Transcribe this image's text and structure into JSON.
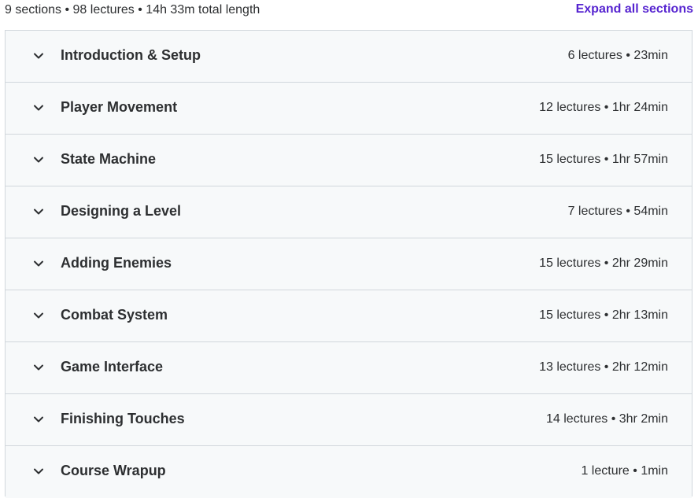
{
  "summary": {
    "text": "9 sections • 98 lectures • 14h 33m total length",
    "expand_label": "Expand all sections"
  },
  "sections": [
    {
      "title": "Introduction & Setup",
      "meta": "6 lectures • 23min"
    },
    {
      "title": "Player Movement",
      "meta": "12 lectures • 1hr 24min"
    },
    {
      "title": "State Machine",
      "meta": "15 lectures • 1hr 57min"
    },
    {
      "title": "Designing a Level",
      "meta": "7 lectures • 54min"
    },
    {
      "title": "Adding Enemies",
      "meta": "15 lectures • 2hr 29min"
    },
    {
      "title": "Combat System",
      "meta": "15 lectures • 2hr 13min"
    },
    {
      "title": "Game Interface",
      "meta": "13 lectures • 2hr 12min"
    },
    {
      "title": "Finishing Touches",
      "meta": "14 lectures • 3hr 2min"
    },
    {
      "title": "Course Wrapup",
      "meta": "1 lecture • 1min"
    }
  ],
  "icons": {
    "section_toggle": "chevron-down-icon"
  },
  "colors": {
    "accent": "#5624d0",
    "text": "#2d2f31",
    "section_bg": "#f7f9fa",
    "border": "#d1d7dc"
  }
}
